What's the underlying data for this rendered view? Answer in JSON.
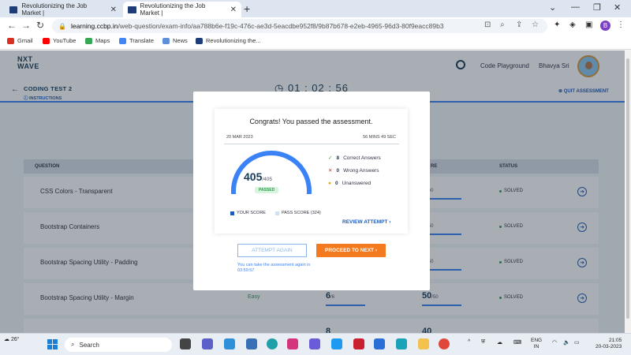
{
  "browser": {
    "tabs": [
      {
        "title": "Revolutionizing the Job Market |"
      },
      {
        "title": "Revolutionizing the Job Market |"
      }
    ],
    "new_tab": "+",
    "url_host": "learning.ccbp.in",
    "url_path": "/web-question/exam-info/aa788b6e-f19c-476c-ae3d-5eacdbe952f8/9b87b678-e2eb-4965-96d3-80f9eacc89b3",
    "profile_initial": "B",
    "bookmarks": [
      "Gmail",
      "YouTube",
      "Maps",
      "Translate",
      "News",
      "Revolutionizing the..."
    ]
  },
  "header": {
    "logo_line1": "NXT",
    "logo_line2": "WAVE",
    "code_playground": "Code Playground",
    "user_name": "Bhavya Sri"
  },
  "subheader": {
    "test_name": "CODING TEST 2",
    "instructions": "INSTRUCTIONS",
    "timer": "01 : 02 : 56",
    "quit": "QUIT ASSESSMENT"
  },
  "table": {
    "columns": {
      "question": "QUESTION",
      "score": "RE",
      "status": "STATUS"
    },
    "rows": [
      {
        "name": "CSS Colors - Transparent",
        "difficulty": "",
        "score1": "",
        "score1_max": "",
        "score2": "0",
        "score2_max": "/60",
        "status": "SOLVED"
      },
      {
        "name": "Bootstrap Containers",
        "difficulty": "",
        "score1": "",
        "score1_max": "",
        "score2": "0",
        "score2_max": "/50",
        "status": "SOLVED"
      },
      {
        "name": "Bootstrap Spacing Utility - Padding",
        "difficulty": "",
        "score1": "",
        "score1_max": "",
        "score2": "0",
        "score2_max": "/50",
        "status": "SOLVED"
      },
      {
        "name": "Bootstrap Spacing Utility - Margin",
        "difficulty": "Easy",
        "score1": "6",
        "score1_max": "/6",
        "score2": "50",
        "score2_max": "/50",
        "status": "SOLVED"
      },
      {
        "name": "",
        "difficulty": "",
        "score1": "8",
        "score1_max": "",
        "score2": "40",
        "score2_max": "",
        "status": ""
      }
    ]
  },
  "modal": {
    "congrats": "Congrats! You passed the assessment.",
    "date": "20 MAR 2023",
    "time_taken": "56 MINS 49 SEC",
    "score": "405",
    "score_max": "/405",
    "score_fraction": 1.0,
    "pass_fraction": 0.8,
    "passed_label": "PASSED",
    "correct_count": "8",
    "correct_label": "Correct Answers",
    "wrong_count": "0",
    "wrong_label": "Wrong Answers",
    "unanswered_count": "0",
    "unanswered_label": "Unanswered",
    "legend_your_score": "YOUR SCORE",
    "legend_pass_score": "PASS SCORE (324)",
    "review_attempt": "REVIEW ATTEMPT",
    "attempt_again": "ATTEMPT AGAIN",
    "proceed": "PROCEED TO NEXT",
    "again_note": "You can take the assessment again in 03:59:57",
    "colors": {
      "accent": "#1e5bb8",
      "orange": "#f47a1f",
      "gauge": "#3b82f6",
      "pass": "#2e9b4f"
    }
  },
  "taskbar": {
    "temperature": "26°",
    "search_placeholder": "Search",
    "lang_line1": "ENG",
    "lang_line2": "IN",
    "time": "21:05",
    "date": "20-03-2023"
  }
}
